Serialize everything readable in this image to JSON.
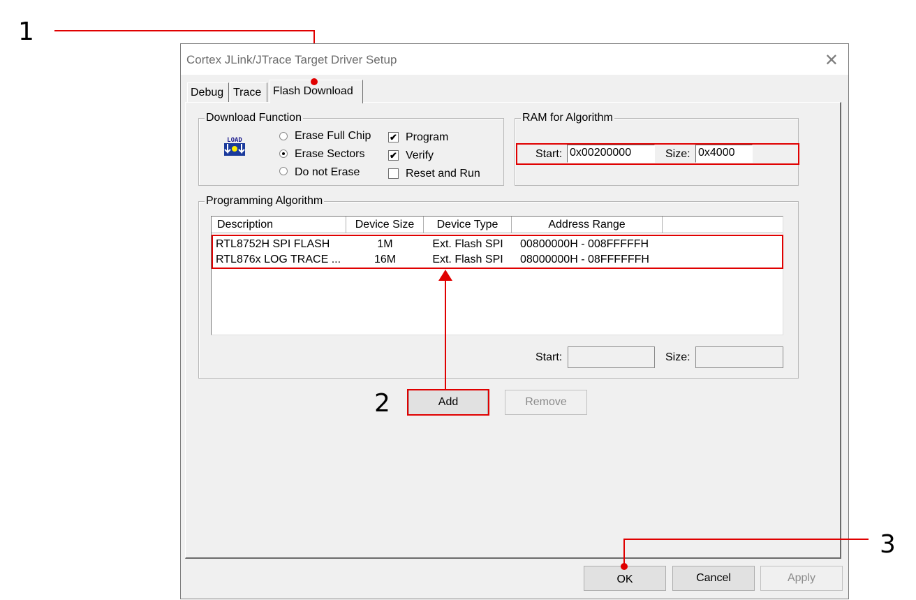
{
  "window": {
    "title": "Cortex JLink/JTrace Target Driver Setup"
  },
  "tabs": [
    {
      "label": "Debug"
    },
    {
      "label": "Trace"
    },
    {
      "label": "Flash Download"
    }
  ],
  "download_function": {
    "title": "Download Function",
    "icon_text": "LOAD",
    "options": [
      {
        "label": "Erase Full Chip",
        "selected": false
      },
      {
        "label": "Erase Sectors",
        "selected": true
      },
      {
        "label": "Do not Erase",
        "selected": false
      }
    ],
    "checks": [
      {
        "label": "Program",
        "checked": true
      },
      {
        "label": "Verify",
        "checked": true
      },
      {
        "label": "Reset and Run",
        "checked": false
      }
    ]
  },
  "ram_for_algorithm": {
    "title": "RAM for Algorithm",
    "start_label": "Start:",
    "start_value": "0x00200000",
    "size_label": "Size:",
    "size_value": "0x4000"
  },
  "programming_algorithm": {
    "title": "Programming Algorithm",
    "columns": [
      "Description",
      "Device Size",
      "Device Type",
      "Address Range"
    ],
    "rows": [
      [
        "RTL8752H SPI FLASH",
        "1M",
        "Ext. Flash SPI",
        "00800000H - 008FFFFFH"
      ],
      [
        "RTL876x LOG TRACE ...",
        "16M",
        "Ext. Flash SPI",
        "08000000H - 08FFFFFFH"
      ]
    ],
    "start_label": "Start:",
    "start_value": "",
    "size_label": "Size:",
    "size_value": ""
  },
  "buttons": {
    "add": "Add",
    "remove": "Remove",
    "ok": "OK",
    "cancel": "Cancel",
    "apply": "Apply"
  },
  "callouts": [
    "1",
    "2",
    "3"
  ],
  "colors": {
    "callout": "#e00000",
    "window_bg": "#f0f0f0"
  }
}
